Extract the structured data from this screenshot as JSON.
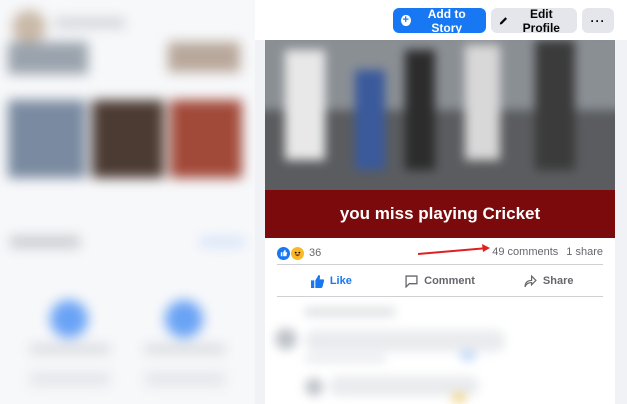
{
  "header": {
    "add_story_label": "Add to Story",
    "edit_profile_label": "Edit Profile",
    "more_label": "···"
  },
  "post": {
    "caption": "you miss playing Cricket",
    "reaction_count": "36",
    "comments_label": "49 comments",
    "shares_label": "1 share",
    "actions": {
      "like": "Like",
      "comment": "Comment",
      "share": "Share"
    }
  },
  "colors": {
    "brand": "#1877f2",
    "caption_band": "#7a0a0c",
    "annotation_arrow": "#e02020"
  },
  "icons": [
    "plus-circle-icon",
    "pencil-icon",
    "more-icon",
    "like-reaction-icon",
    "haha-reaction-icon",
    "thumbs-up-icon",
    "comment-icon",
    "share-icon"
  ]
}
